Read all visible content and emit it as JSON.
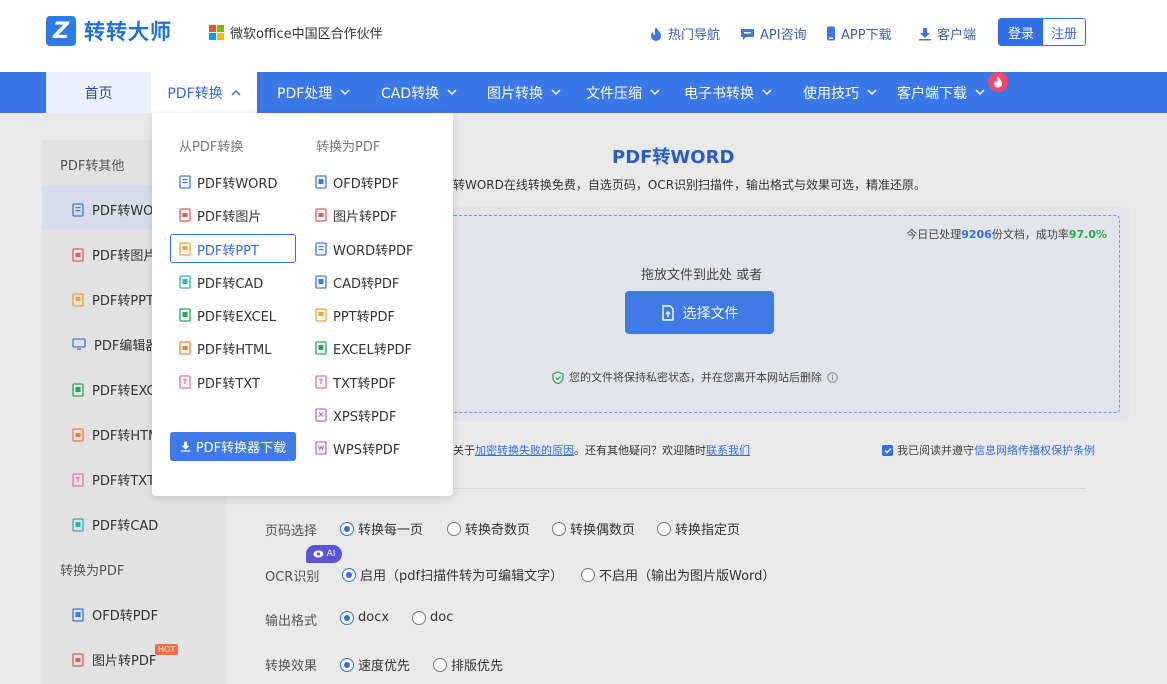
{
  "header": {
    "logo_mark": "Z",
    "logo_text": "转转大师",
    "partner_text": "微软office中国区合作伙伴",
    "links": [
      {
        "label": "热门导航",
        "icon": "flame-icon"
      },
      {
        "label": "API咨询",
        "icon": "chat-icon"
      },
      {
        "label": "APP下载",
        "icon": "phone-icon"
      },
      {
        "label": "客户端",
        "icon": "download-icon"
      }
    ],
    "login": "登录",
    "register": "注册"
  },
  "nav": {
    "items": [
      "首页",
      "PDF转换",
      "PDF处理",
      "CAD转换",
      "图片转换",
      "文件压缩",
      "电子书转换",
      "使用技巧",
      "客户端下载"
    ],
    "active_index": 1
  },
  "sidebar": {
    "section1": "PDF转其他",
    "items1": [
      {
        "label": "PDF转WO",
        "color": "#3b78e7"
      },
      {
        "label": "PDF转图片",
        "color": "#e05a5a"
      },
      {
        "label": "PDF转PPT",
        "color": "#f0a030"
      },
      {
        "label": "PDF编辑器",
        "color": "#3b78e7"
      },
      {
        "label": "PDF转EXC",
        "color": "#25a55f"
      },
      {
        "label": "PDF转HTM",
        "color": "#f07c3c"
      },
      {
        "label": "PDF转TXT",
        "color": "#e96fa8"
      },
      {
        "label": "PDF转CAD",
        "color": "#2bb5a5"
      }
    ],
    "section2": "转换为PDF",
    "items2": [
      {
        "label": "OFD转PDF",
        "color": "#3b78e7"
      },
      {
        "label": "图片转PDF",
        "color": "#e05a5a"
      }
    ],
    "hot": "HOT"
  },
  "main": {
    "title": "PDF转WORD",
    "description": "转WORD在线转换免费，自选页码，OCR识别扫描件，输出格式与效果可选，精准还原。",
    "stats_prefix": "今日已处理",
    "stats_count": "9206",
    "stats_mid": "份文档，成功率",
    "stats_rate": "97.0%",
    "drop_text": "拖放文件到此处 或者",
    "choose_button": "选择文件",
    "privacy_text": "您的文件将保持私密状态，并在您离开本网站后删除",
    "help_prefix": "关于",
    "help_link1": "加密转换失败的原因",
    "help_mid": "。还有其他疑问？欢迎随时",
    "help_link2": "联系我们",
    "agree_prefix": "我已阅读并遵守",
    "agree_link": "信息网络传播权保护条例"
  },
  "options": {
    "page": {
      "label": "页码选择",
      "choices": [
        "转换每一页",
        "转换奇数页",
        "转换偶数页",
        "转换指定页"
      ],
      "selected": 0
    },
    "ocr": {
      "label": "OCR识别",
      "badge": "AI",
      "choices": [
        "启用（pdf扫描件转为可编辑文字）",
        "不启用（输出为图片版Word）"
      ],
      "selected": 0
    },
    "format": {
      "label": "输出格式",
      "choices": [
        "docx",
        "doc"
      ],
      "selected": 0
    },
    "effect": {
      "label": "转换效果",
      "choices": [
        "速度优先",
        "排版优先"
      ],
      "selected": 0
    }
  },
  "dropdown": {
    "col1_title": "从PDF转换",
    "col2_title": "转换为PDF",
    "col1": [
      {
        "label": "PDF转WORD",
        "color": "#3b78e7"
      },
      {
        "label": "PDF转图片",
        "color": "#e05a5a"
      },
      {
        "label": "PDF转PPT",
        "color": "#f0a030"
      },
      {
        "label": "PDF转CAD",
        "color": "#2bb5a5"
      },
      {
        "label": "PDF转EXCEL",
        "color": "#25a55f"
      },
      {
        "label": "PDF转HTML",
        "color": "#f07c3c"
      },
      {
        "label": "PDF转TXT",
        "color": "#e96fa8"
      }
    ],
    "col2": [
      {
        "label": "OFD转PDF",
        "color": "#3b78e7"
      },
      {
        "label": "图片转PDF",
        "color": "#e05a5a"
      },
      {
        "label": "WORD转PDF",
        "color": "#3b78e7"
      },
      {
        "label": "CAD转PDF",
        "color": "#3b78e7"
      },
      {
        "label": "PPT转PDF",
        "color": "#f0a030"
      },
      {
        "label": "EXCEL转PDF",
        "color": "#25a55f"
      },
      {
        "label": "TXT转PDF",
        "color": "#e96fa8"
      },
      {
        "label": "XPS转PDF",
        "color": "#b06ae0"
      },
      {
        "label": "WPS转PDF",
        "color": "#b06ae0"
      }
    ],
    "selected_col1_index": 2,
    "download_button": "PDF转换器下载"
  }
}
